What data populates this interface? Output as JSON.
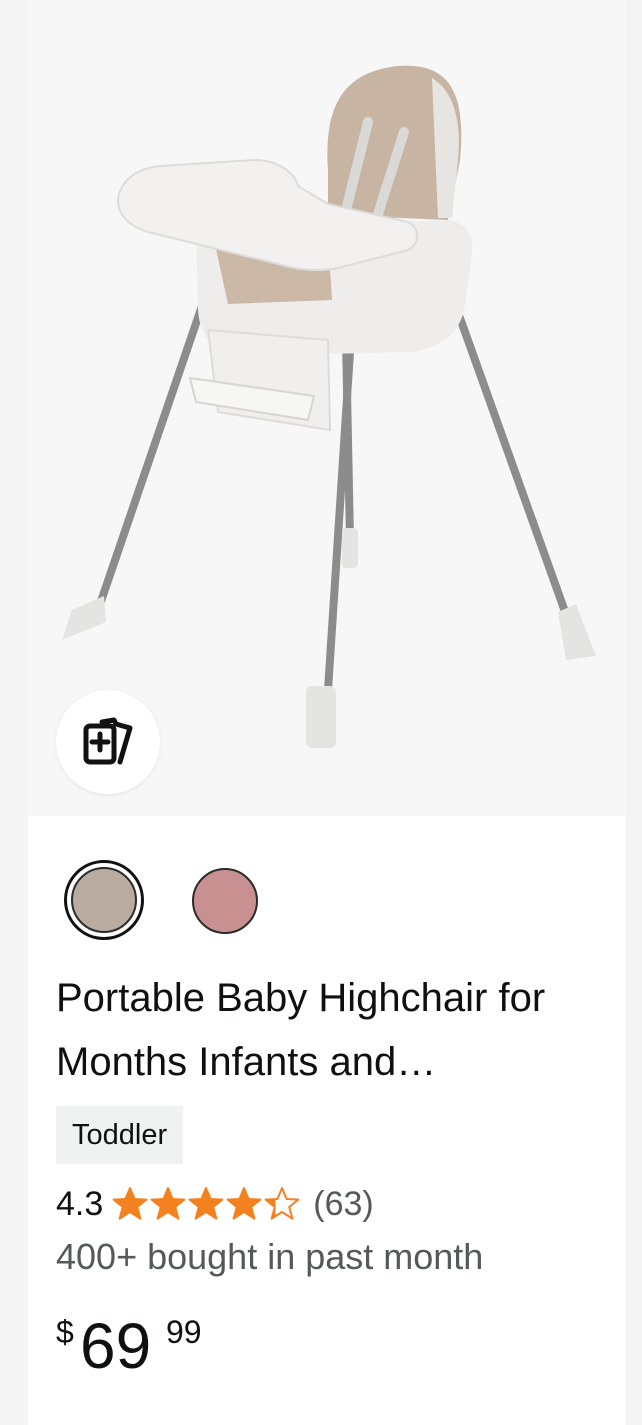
{
  "product": {
    "title": "Portable Baby Highchair for Months Infants and…",
    "tag": "Toddler",
    "rating": "4.3",
    "stars_value": 4.3,
    "stars_max": 5,
    "review_count": "(63)",
    "bought_text": "400+ bought in past month",
    "price": {
      "symbol": "$",
      "whole": "69",
      "fraction": "99"
    },
    "image_alt": "Portable baby highchair product image",
    "swatches": [
      {
        "color": "#b9aba0",
        "selected": true
      },
      {
        "color": "#c89090",
        "selected": false
      }
    ]
  },
  "icons": {
    "compare": "compare-cards-icon",
    "star": "star-icon"
  },
  "colors": {
    "star": "#f3811f",
    "muted_text": "#565959",
    "tag_bg": "#f0f2f2",
    "image_bg": "#f7f7f7"
  }
}
